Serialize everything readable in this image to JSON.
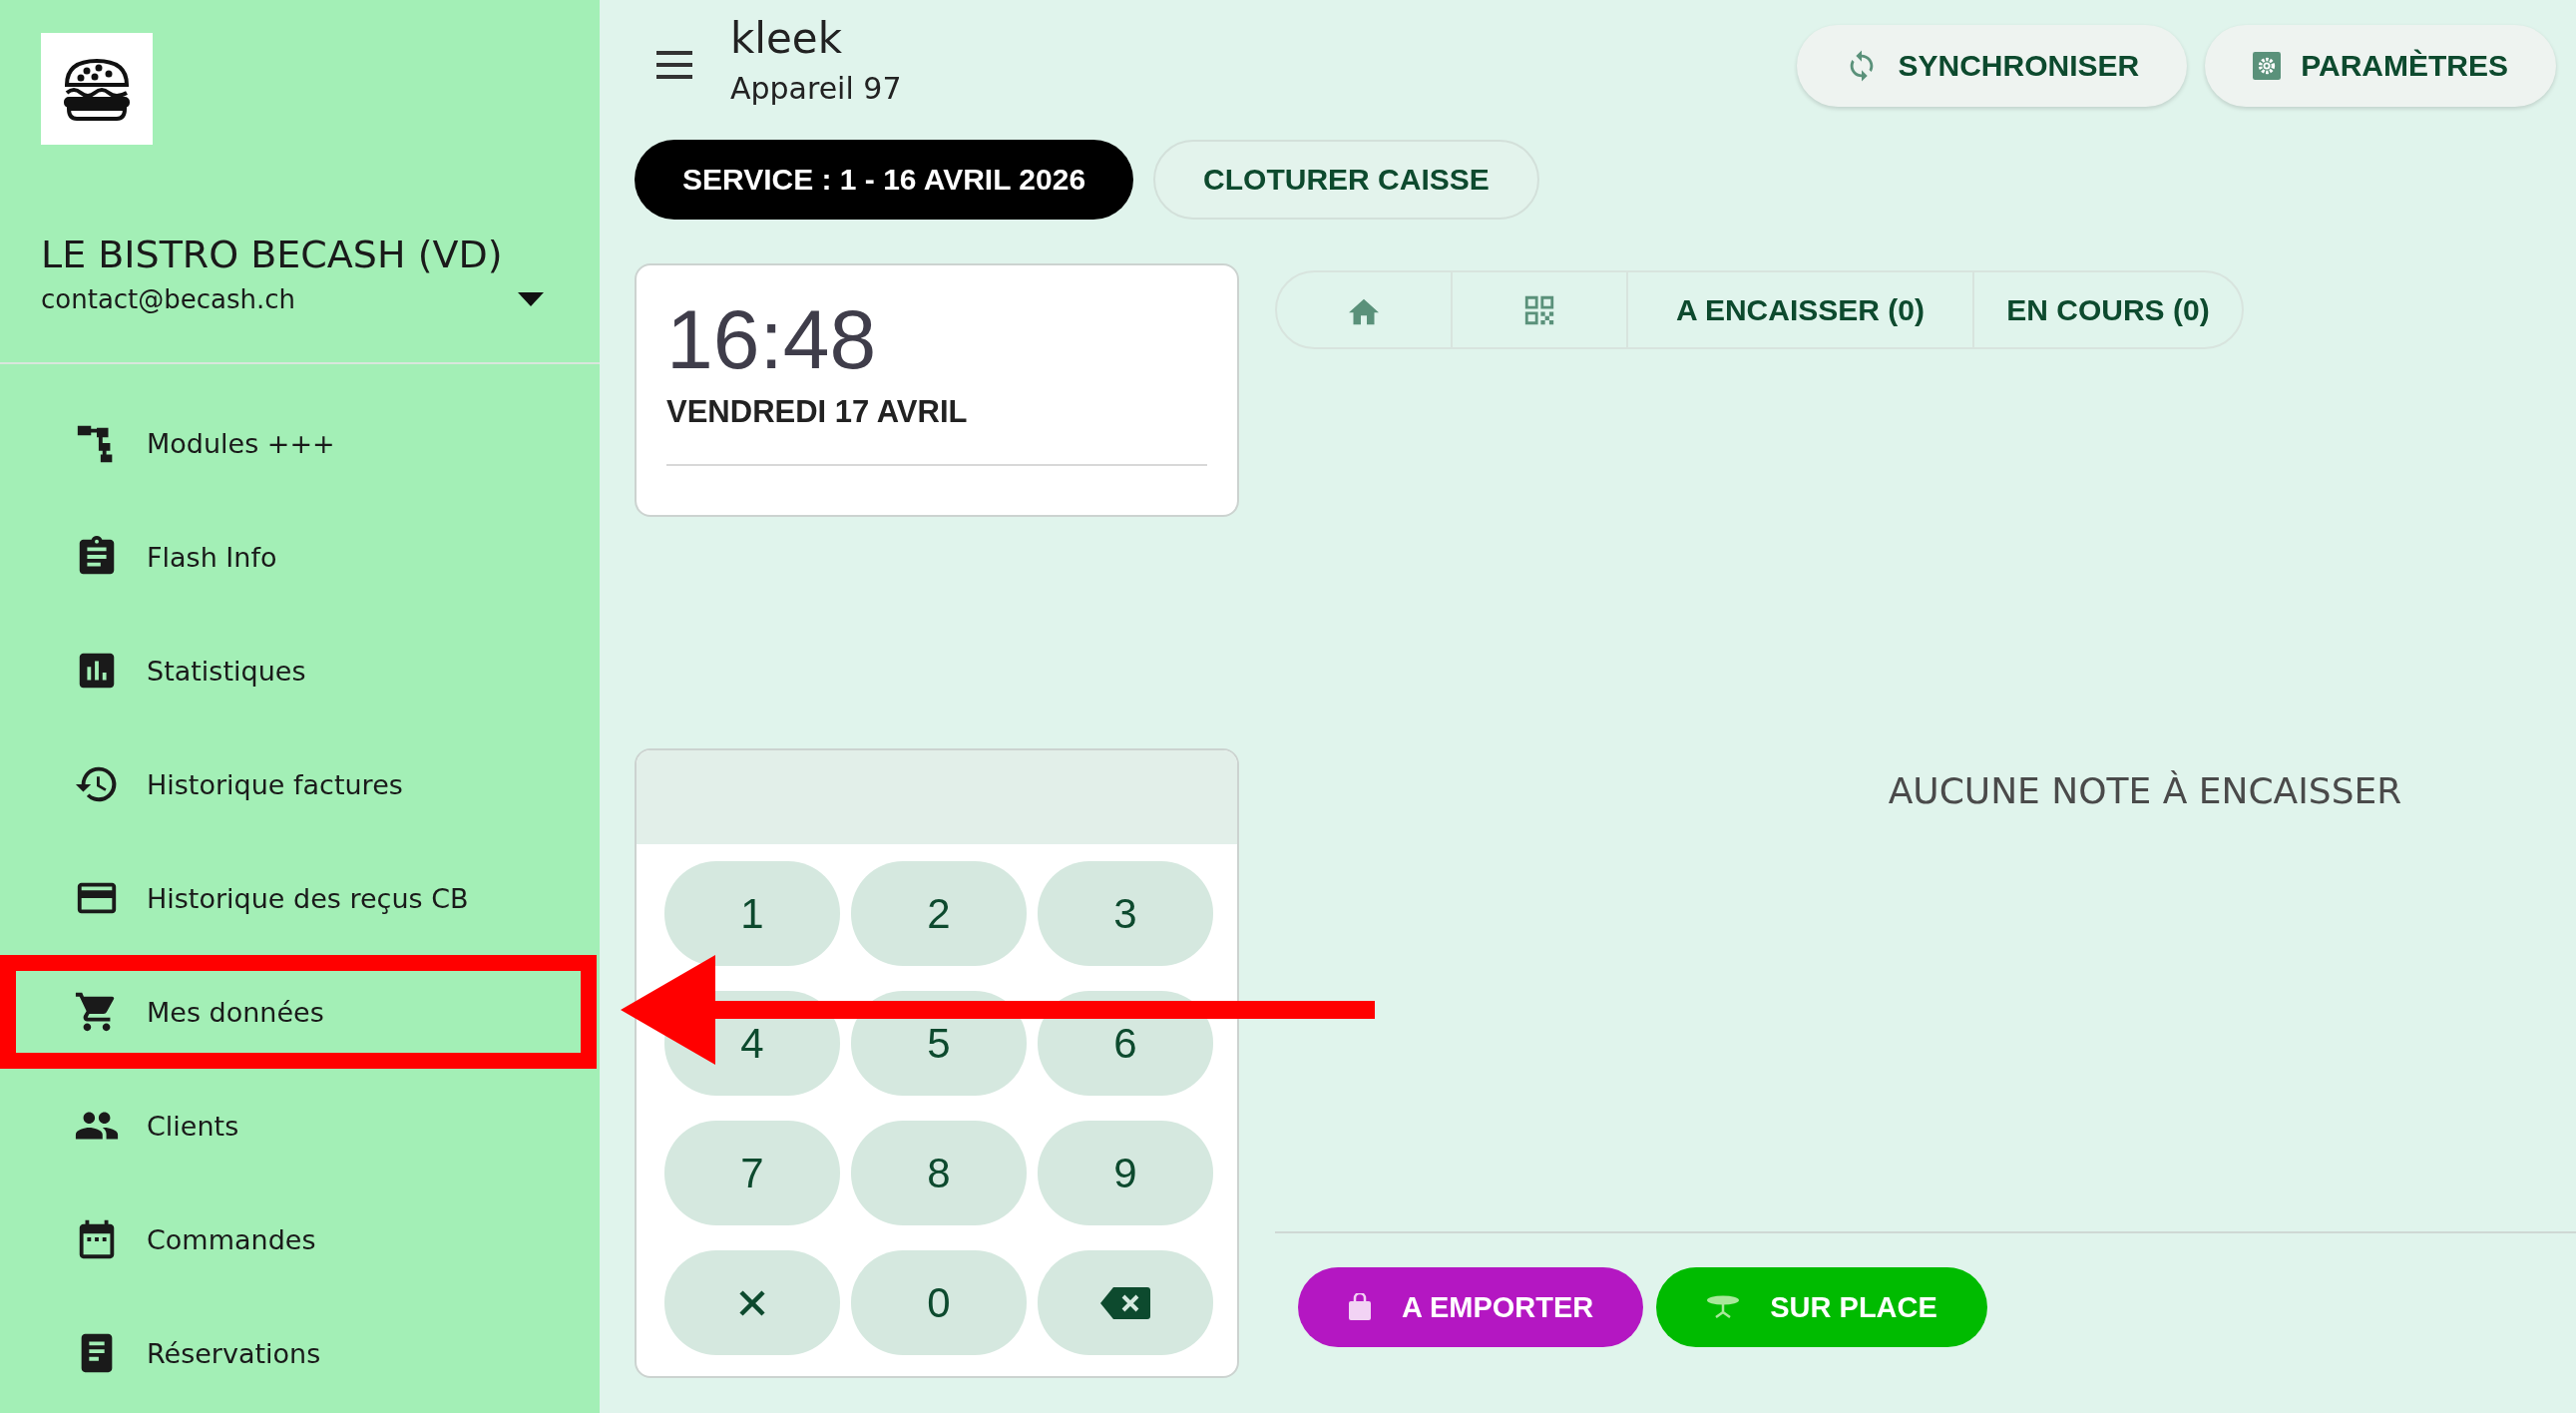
{
  "sidebar": {
    "business_name": "LE BISTRO BECASH (VD)",
    "email": "contact@becash.ch",
    "items": [
      {
        "label": "Modules +++",
        "highlighted": false
      },
      {
        "label": "Flash Info",
        "highlighted": false
      },
      {
        "label": "Statistiques",
        "highlighted": false
      },
      {
        "label": "Historique factures",
        "highlighted": false
      },
      {
        "label": "Historique des reçus CB",
        "highlighted": false
      },
      {
        "label": "Mes données",
        "highlighted": true
      },
      {
        "label": "Clients",
        "highlighted": false
      },
      {
        "label": "Commandes",
        "highlighted": false
      },
      {
        "label": "Réservations",
        "highlighted": false
      }
    ]
  },
  "header": {
    "title": "kleek",
    "subtitle": "Appareil 97",
    "actions": [
      "SYNCHRONISER",
      "PARAMÈTRES"
    ]
  },
  "service": {
    "label": "SERVICE : 1 - 16 AVRIL 2026",
    "close_button": "CLOTURER CAISSE"
  },
  "clock": {
    "time": "16:48",
    "date": "VENDREDI 17 AVRIL"
  },
  "tabs": [
    "A ENCAISSER (0)",
    "EN COURS (0)"
  ],
  "empty_message": "AUCUNE NOTE À ENCAISSER",
  "keypad": {
    "keys": [
      "1",
      "2",
      "3",
      "4",
      "5",
      "6",
      "7",
      "8",
      "9",
      "0"
    ]
  },
  "order_buttons": [
    {
      "label": "A EMPORTER",
      "color": "#b417c2"
    },
    {
      "label": "SUR PLACE",
      "color": "#00bb00"
    }
  ]
}
